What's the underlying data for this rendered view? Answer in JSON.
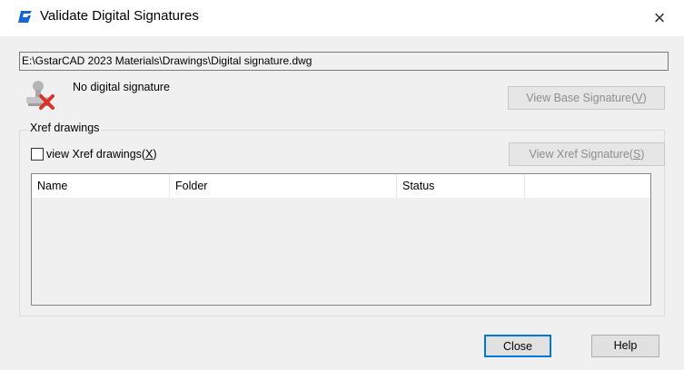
{
  "window": {
    "title": "Validate Digital Signatures",
    "close_glyph": "×",
    "app_icon": "gstarcad-logo-icon",
    "accent_color": "#1565d8"
  },
  "file": {
    "path": "E:\\GstarCAD 2023 Materials\\Drawings\\Digital signature.dwg"
  },
  "signature": {
    "status_text": "No digital signature",
    "status_icon": "no-signature-icon",
    "view_base_button": {
      "label": "View Base Signature(",
      "hotkey": "V",
      "suffix": ")"
    }
  },
  "xref": {
    "group_label": "Xref drawings",
    "checkbox": {
      "label": "view Xref drawings(",
      "hotkey": "X",
      "suffix": ")",
      "checked": false
    },
    "view_xref_button": {
      "label": "View Xref Signature(",
      "hotkey": "S",
      "suffix": ")"
    },
    "columns": [
      "Name",
      "Folder",
      "Status",
      ""
    ],
    "rows": []
  },
  "footer": {
    "close_label": "Close",
    "help_label": "Help"
  }
}
